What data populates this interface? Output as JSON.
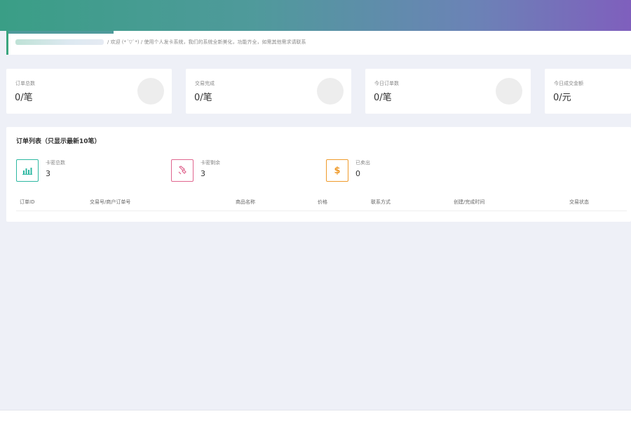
{
  "colors": {
    "header_gradient_start": "#3a9e86",
    "header_gradient_end": "#7f5fbd",
    "welcome_accent": "#3aa57e",
    "page_background": "#eef0f7",
    "card_background": "#ffffff",
    "teal_accent": "#2eb8a2",
    "pink_accent": "#e0668f",
    "orange_accent": "#ef9b2c"
  },
  "welcome": {
    "text": "/ 欢迎 (*´▽`*) / 使用个人发卡系统，我们的系统全新美化，功能齐全，如需其他需求请联系"
  },
  "stats": [
    {
      "label": "订单总数",
      "value": "0/笔"
    },
    {
      "label": "交易完成",
      "value": "0/笔"
    },
    {
      "label": "今日订单数",
      "value": "0/笔"
    },
    {
      "label": "今日成交金额",
      "value": "0/元"
    }
  ],
  "orders": {
    "title": "订单列表（只显示最新10笔）",
    "summary": [
      {
        "label": "卡密总数",
        "value": "3",
        "icon": "bar-chart-icon"
      },
      {
        "label": "卡密剩余",
        "value": "3",
        "icon": "hand-pointer-icon"
      },
      {
        "label": "已卖出",
        "value": "0",
        "icon": "dollar-icon",
        "glyph": "$"
      }
    ],
    "columns": [
      "订单ID",
      "交易号/商户订单号",
      "商品名称",
      "价格",
      "联系方式",
      "创建/完成时间",
      "交易状态"
    ]
  }
}
